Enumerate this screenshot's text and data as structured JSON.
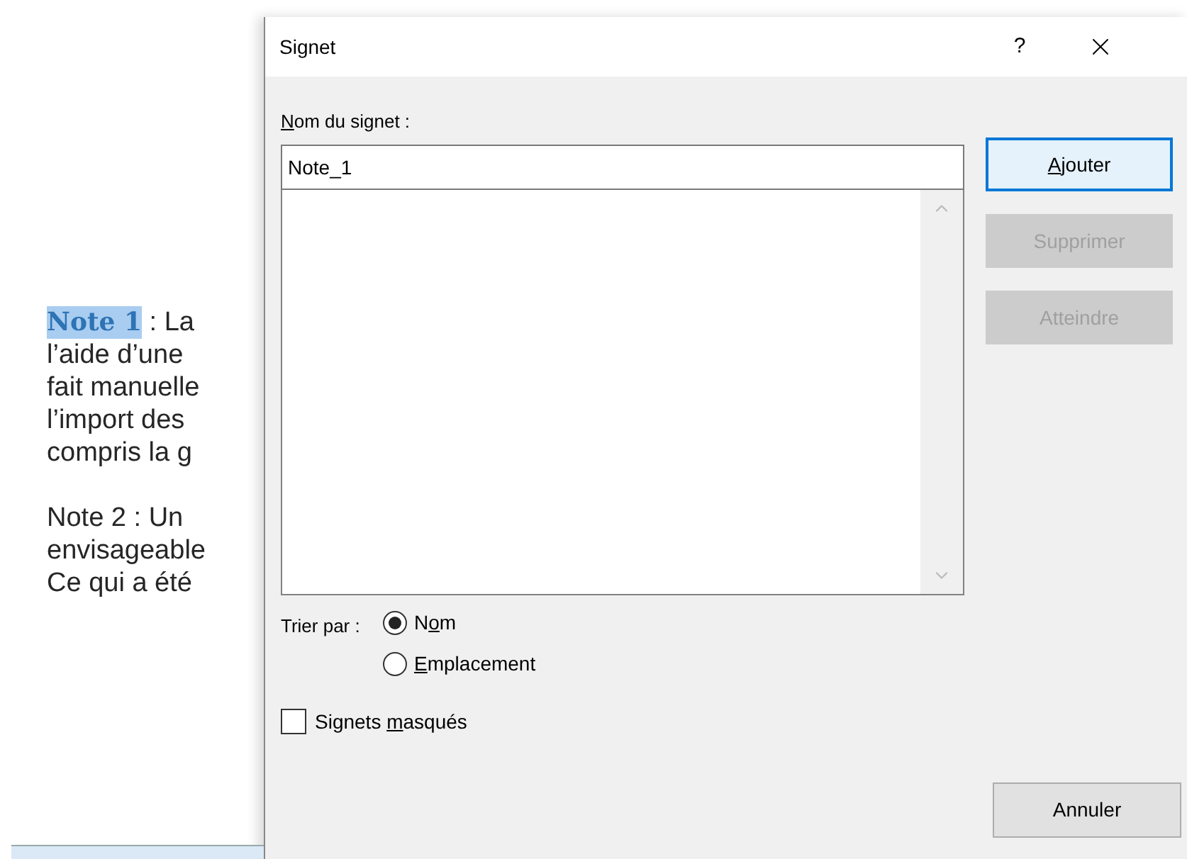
{
  "document": {
    "paragraphs": [
      {
        "highlighted_heading": "Note 1",
        "lines": [
          " : La",
          "l’aide d’une",
          "fait manuelle",
          "l’import des",
          "compris la g"
        ]
      },
      {
        "lines": [
          "Note 2 : Un",
          "envisageable",
          "Ce qui a été"
        ]
      }
    ]
  },
  "dialog": {
    "title": "Signet",
    "help": "?",
    "name_label": {
      "key": "N",
      "post": "om du signet :"
    },
    "name_value": "Note_1",
    "buttons": [
      {
        "key": "A",
        "post": "jouter",
        "disabled": false,
        "default": true
      },
      {
        "pre": "Supprimer",
        "disabled": true,
        "default": false
      },
      {
        "pre": "Atteindre",
        "disabled": true,
        "default": false
      }
    ],
    "sort_label": "Trier par :",
    "sort_options": [
      {
        "pre": "N",
        "key": "o",
        "post": "m",
        "selected": true
      },
      {
        "key": "E",
        "post": "mplacement",
        "selected": false
      }
    ],
    "hidden": {
      "pre": "Signets ",
      "key": "m",
      "post": "asqués",
      "checked": false
    },
    "cancel": "Annuler"
  }
}
